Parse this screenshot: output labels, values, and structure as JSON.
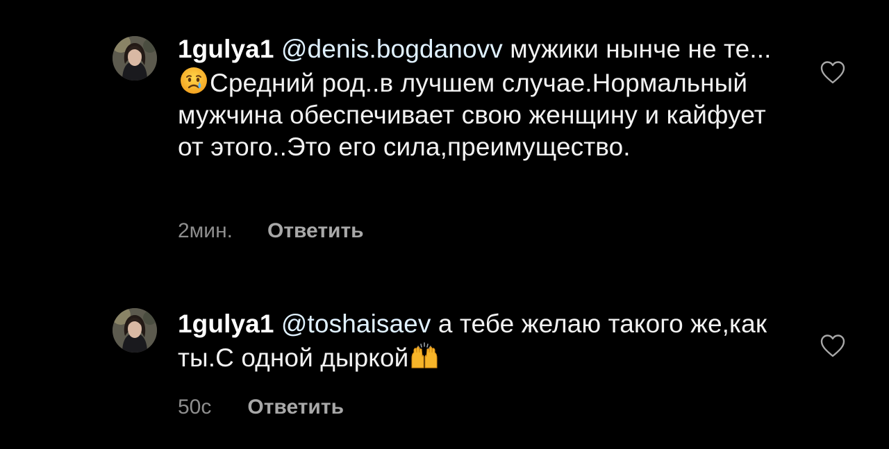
{
  "comments": [
    {
      "username": "1gulya1",
      "mention": "@denis.bogdanovv",
      "text_before_emoji": " мужики нынче не те...",
      "emoji": "crying-face",
      "text_after_emoji": "Средний род..в лучшем случае.Нормальный мужчина обеспечивает свою женщину и кайфует от этого..Это его сила,преимущество.",
      "time": "2мин.",
      "reply_label": "Ответить"
    },
    {
      "username": "1gulya1",
      "mention": "@toshaisaev",
      "text_before_emoji": " а тебе желаю такого же,как ты.С одной дыркой",
      "emoji": "raising-hands",
      "text_after_emoji": "",
      "time": "50с",
      "reply_label": "Ответить"
    }
  ],
  "colors": {
    "background": "#000000",
    "text": "#f2f2f2",
    "mention": "#e0f1ff",
    "meta": "#8e8e8e"
  },
  "icons": {
    "like": "heart-outline-icon",
    "avatar": "user-avatar"
  }
}
